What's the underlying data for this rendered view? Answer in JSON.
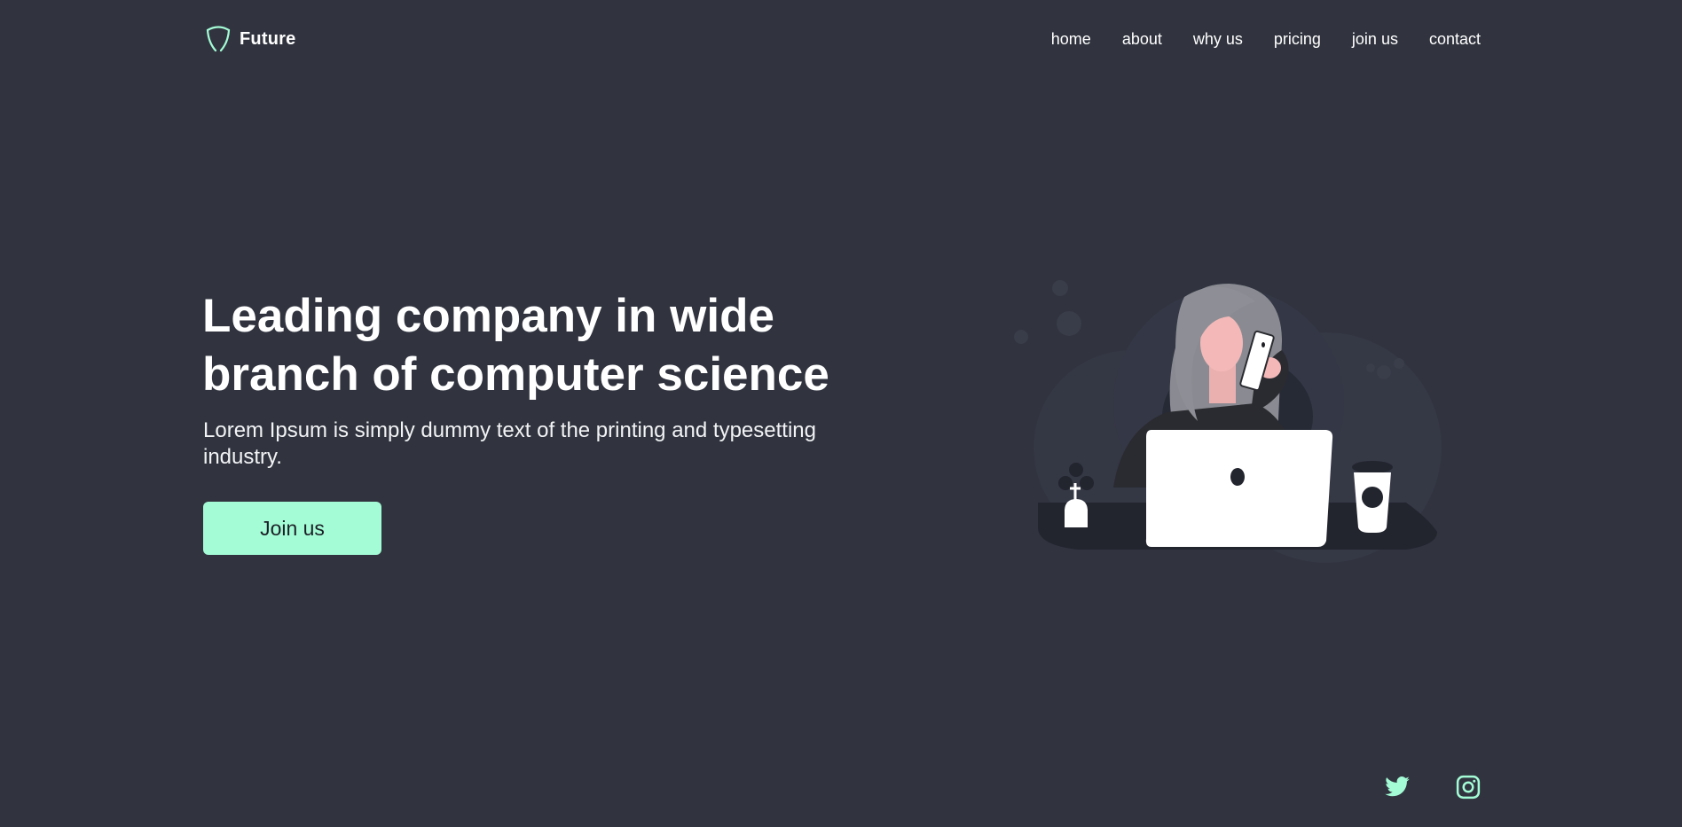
{
  "brand": {
    "name": "Future",
    "accent": "#a4fcd6",
    "background": "#31343f"
  },
  "nav": {
    "items": [
      "home",
      "about",
      "why us",
      "pricing",
      "join us",
      "contact"
    ]
  },
  "hero": {
    "title": "Leading company in wide branch of computer science",
    "subtitle": "Lorem Ipsum is simply dummy text of the printing and typesetting industry.",
    "cta_label": "Join us"
  },
  "illustration": {
    "icon": "woman-on-phone-with-laptop-illustration"
  },
  "social": {
    "icons": [
      "twitter-icon",
      "instagram-icon"
    ]
  }
}
